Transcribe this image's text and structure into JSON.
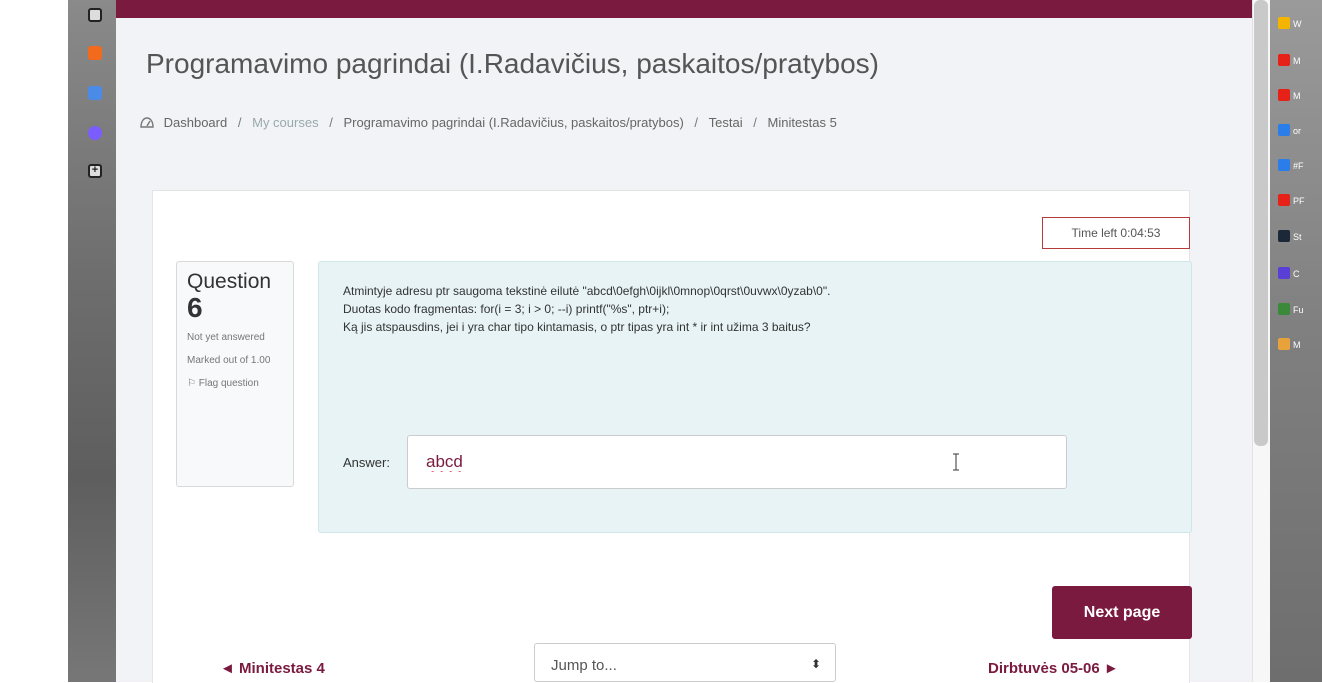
{
  "course": {
    "title": "Programavimo pagrindai (I.Radavičius, paskaitos/pratybos)"
  },
  "breadcrumb": {
    "items": [
      "Dashboard",
      "My courses",
      "Programavimo pagrindai (I.Radavičius, paskaitos/pratybos)",
      "Testai",
      "Minitestas 5"
    ],
    "separator": "/"
  },
  "timer": {
    "label": "Time left 0:04:53"
  },
  "question": {
    "label": "Question",
    "number": "6",
    "status": "Not yet answered",
    "marked": "Marked out of 1.00",
    "flag_label": "Flag question",
    "text_lines": [
      "Atmintyje adresu ptr saugoma tekstinė eilutė \"abcd\\0efgh\\0ijkl\\0mnop\\0qrst\\0uvwx\\0yzab\\0\".",
      "Duotas kodo fragmentas: for(i = 3; i > 0; --i) printf(\"%s\", ptr+i);",
      "Ką jis atspausdins, jei i yra char tipo kintamasis, o ptr tipas yra int * ir int užima 3 baitus?"
    ],
    "answer_label": "Answer:",
    "answer_value": "abcd"
  },
  "actions": {
    "next_page": "Next page"
  },
  "navigation": {
    "prev": "◄ Minitestas 4",
    "jump_placeholder": "Jump to...",
    "next": "Dirbtuvės 05-06 ►"
  },
  "right_panel": {
    "items": [
      {
        "label": "W",
        "icon": "windows-icon",
        "color": "#f4b400"
      },
      {
        "label": "M",
        "icon": "youtube-icon",
        "color": "#e62117"
      },
      {
        "label": "M",
        "icon": "youtube-icon",
        "color": "#e62117"
      },
      {
        "label": "or",
        "icon": "p-icon",
        "color": "#2b7de9"
      },
      {
        "label": "#F",
        "icon": "p-icon",
        "color": "#2b7de9"
      },
      {
        "label": "PF",
        "icon": "youtube-icon",
        "color": "#e62117"
      },
      {
        "label": "St",
        "icon": "steam-icon",
        "color": "#1b2838"
      },
      {
        "label": "C",
        "icon": "wand-icon",
        "color": "#5a3fd6"
      },
      {
        "label": "Fu",
        "icon": "leaf-icon",
        "color": "#3a8a3a"
      },
      {
        "label": "M",
        "icon": "folder-icon",
        "color": "#e8a23c"
      }
    ]
  },
  "colors": {
    "brand": "#7b1a3f",
    "timer_border": "#b53a3a",
    "question_bg": "#e7f3f5"
  }
}
